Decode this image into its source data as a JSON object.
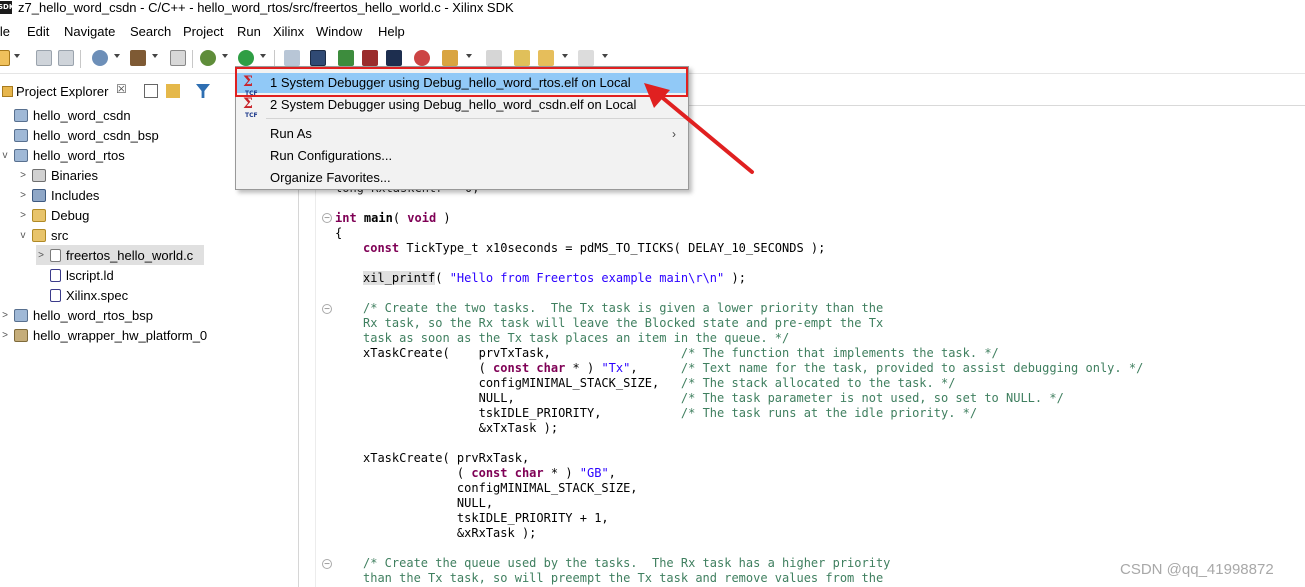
{
  "window": {
    "logo_text": "SDK",
    "title": "z7_hello_word_csdn - C/C++ - hello_word_rtos/src/freertos_hello_world.c - Xilinx SDK"
  },
  "menubar": [
    "File",
    "Edit",
    "Navigate",
    "Search",
    "Project",
    "Run",
    "Xilinx",
    "Window",
    "Help"
  ],
  "menubar_visible": [
    "ile",
    "Edit",
    "Navigate",
    "Search",
    "Project",
    "Run",
    "Xilinx",
    "Window",
    "Help"
  ],
  "explorer": {
    "title": "Project Explorer",
    "close_glyph": "☒",
    "tree": [
      {
        "label": "hello_word_csdn",
        "icon": "project-icon",
        "twisty": ""
      },
      {
        "label": "hello_word_csdn_bsp",
        "icon": "project-icon",
        "twisty": ""
      },
      {
        "label": "hello_word_rtos",
        "icon": "project-open-icon",
        "twisty": "v"
      },
      {
        "label": "Binaries",
        "icon": "binaries-icon",
        "twisty": ">"
      },
      {
        "label": "Includes",
        "icon": "includes-icon",
        "twisty": ">"
      },
      {
        "label": "Debug",
        "icon": "folder-icon",
        "twisty": ">"
      },
      {
        "label": "src",
        "icon": "folder-open-icon",
        "twisty": "v"
      },
      {
        "label": "freertos_hello_world.c",
        "icon": "c-file-icon",
        "twisty": ">"
      },
      {
        "label": "lscript.ld",
        "icon": "linker-file-icon",
        "twisty": ""
      },
      {
        "label": "Xilinx.spec",
        "icon": "spec-file-icon",
        "twisty": ""
      },
      {
        "label": "hello_word_rtos_bsp",
        "icon": "project-icon",
        "twisty": ">"
      },
      {
        "label": "hello_wrapper_hw_platform_0",
        "icon": "hw-platform-icon",
        "twisty": ">"
      }
    ]
  },
  "dropdown": {
    "items": [
      {
        "label": "1 System Debugger using Debug_hello_word_rtos.elf on Local",
        "icon": "tcf-icon",
        "icon_text": "TCF"
      },
      {
        "label": "2 System Debugger using Debug_hello_word_csdn.elf on Local",
        "icon": "tcf-icon",
        "icon_text": "TCF"
      },
      {
        "label": "Run As",
        "submenu": "›"
      },
      {
        "label": "Run Configurations..."
      },
      {
        "label": "Organize Favorites..."
      }
    ]
  },
  "editor": {
    "lines": {
      "l_main": "int main( void )",
      "l_brace": "{",
      "l_const": "const TickType_t x10seconds = pdMS_TO_TICKS( DELAY_10_SECONDS );",
      "l_printf_fn": "xil_printf",
      "l_printf_rest": "( \"Hello from Freertos example main\\r\\n\" );",
      "c1": "/* Create the two tasks.  The Tx task is given a lower priority than the",
      "c2": "Rx task, so the Rx task will leave the Blocked state and pre-empt the Tx",
      "c3": "task as soon as the Tx task places an item in the queue. */",
      "t1": "xTaskCreate(    prvTxTask,                  /* The function that implements the task. */",
      "t2": "                ( const char * ) \"Tx\",      /* Text name for the task, provided to assist debugging only. */",
      "t3": "                configMINIMAL_STACK_SIZE,   /* The stack allocated to the task. */",
      "t4": "                NULL,                       /* The task parameter is not used, so set to NULL. */",
      "t5": "                tskIDLE_PRIORITY,           /* The task runs at the idle priority. */",
      "t6": "                &xTxTask );",
      "r1": "xTaskCreate( prvRxTask,",
      "r2": "             ( const char * ) \"GB\",",
      "r3": "             configMINIMAL_STACK_SIZE,",
      "r4": "             NULL,",
      "r5": "             tskIDLE_PRIORITY + 1,",
      "r6": "             &xRxTask );",
      "q1": "/* Create the queue used by the tasks.  The Rx task has a higher priority",
      "q2": "than the Tx task, so will preempt the Tx task and remove values from the",
      "partial": "long RxtaskCntr = 0;"
    }
  },
  "watermark": "CSDN @qq_41998872",
  "colors": {
    "highlight": "#91c9f7",
    "annotation_red": "#e02020",
    "keyword": "#7f0055",
    "string": "#2a00ff",
    "comment": "#3f7f5f"
  }
}
